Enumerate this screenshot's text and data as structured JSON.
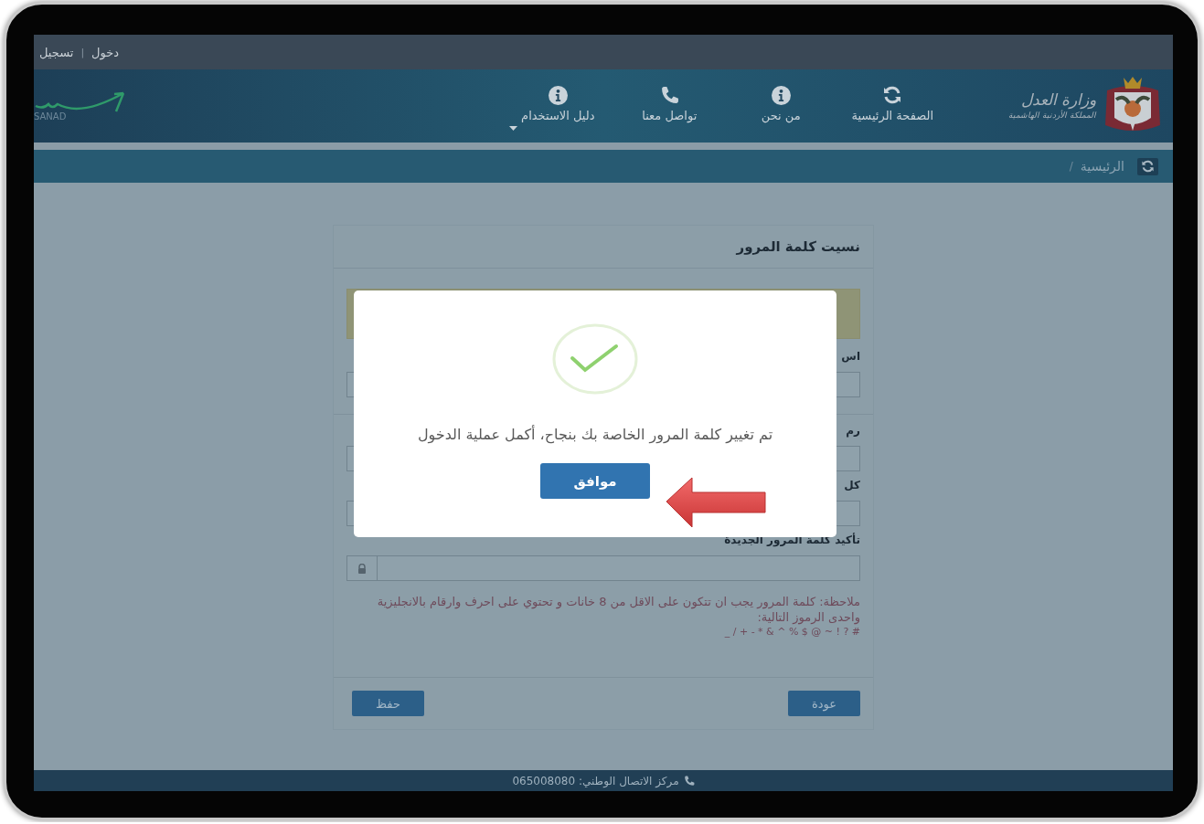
{
  "top_bar": {
    "links": [
      "دخول",
      "تسجيل"
    ],
    "separator": "|"
  },
  "header": {
    "logo": {
      "title": "وزارة العدل",
      "subtitle": "المملكة الأردنية الهاشمية"
    },
    "nav": [
      {
        "label": "الصفحة الرئيسية",
        "kind": "refresh",
        "dropdown": false
      },
      {
        "label": "من نحن",
        "kind": "info",
        "dropdown": false
      },
      {
        "label": "تواصل معنا",
        "kind": "phone",
        "dropdown": false
      },
      {
        "label": "دليل الاستخدام",
        "kind": "info",
        "dropdown": true
      }
    ],
    "brand": {
      "name": "SANAD"
    }
  },
  "breadcrumb": {
    "items": [
      "الرئيسية"
    ],
    "separator": "/"
  },
  "card": {
    "title": "نسيت كلمة المرور",
    "sections": [
      [
        {
          "label": "اس"
        }
      ],
      [
        {
          "label": "رم"
        },
        {
          "label": "كل"
        },
        {
          "label": "تأكيد كلمة المرور الجديدة"
        }
      ]
    ],
    "note": "ملاحظة: كلمة المرور يجب ان تتكون على الاقل من 8 خانات و تحتوي على احرف وارقام بالانجليزية واحدى الرموز التالية:",
    "symbols": "# ? ! ~ @ $ % ^ & * - + / _",
    "buttons": [
      {
        "label": "عودة"
      },
      {
        "label": "حفظ"
      }
    ]
  },
  "modal": {
    "message": "تم تغيير كلمة المرور الخاصة بك بنجاح، أكمل عملية الدخول",
    "button": "موافق"
  },
  "footer": {
    "text": "مركز الاتصال الوطني: 065008080"
  }
}
